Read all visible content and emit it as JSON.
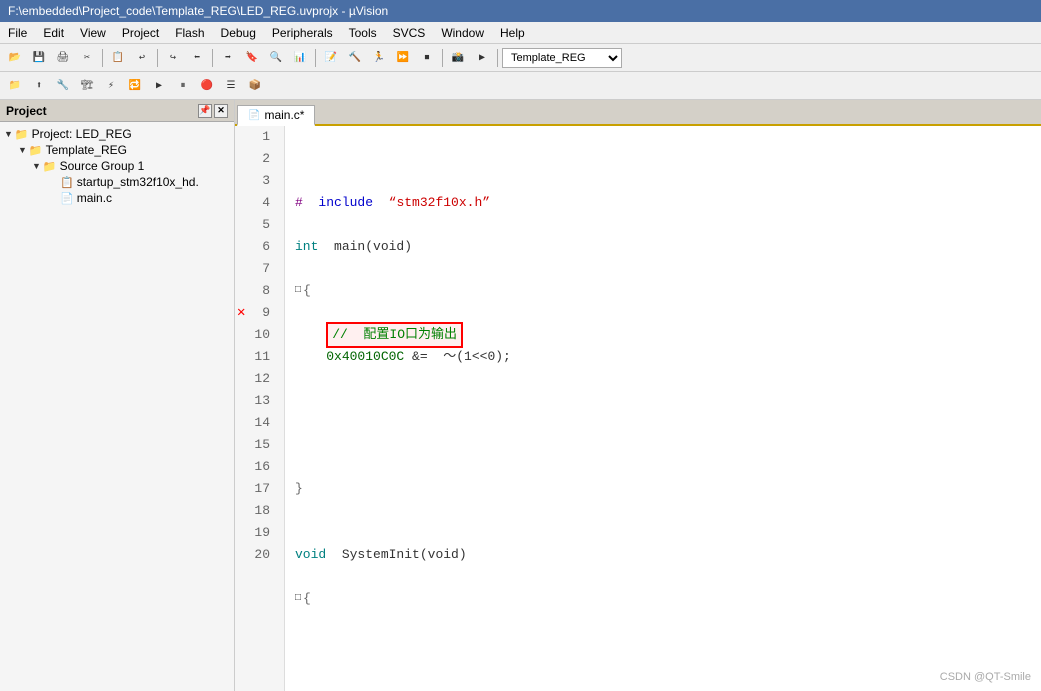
{
  "title": "F:\\embedded\\Project_code\\Template_REG\\LED_REG.uvprojx - µVision",
  "menu": {
    "items": [
      "File",
      "Edit",
      "View",
      "Project",
      "Flash",
      "Debug",
      "Peripherals",
      "Tools",
      "SVCS",
      "Window",
      "Help"
    ]
  },
  "toolbar1": {
    "project_dropdown": "Template_REG"
  },
  "project_panel": {
    "title": "Project",
    "tree": [
      {
        "label": "Project: LED_REG",
        "level": 0,
        "type": "project",
        "expanded": true
      },
      {
        "label": "Template_REG",
        "level": 1,
        "type": "folder",
        "expanded": true
      },
      {
        "label": "Source Group 1",
        "level": 2,
        "type": "folder",
        "expanded": true
      },
      {
        "label": "startup_stm32f10x_hd.",
        "level": 3,
        "type": "asm"
      },
      {
        "label": "main.c",
        "level": 3,
        "type": "c"
      }
    ]
  },
  "editor": {
    "tab_name": "main.c*",
    "lines": [
      {
        "num": 1,
        "content": "",
        "type": "normal"
      },
      {
        "num": 2,
        "content": "#  include  “stm32f10x.h”",
        "type": "include"
      },
      {
        "num": 3,
        "content": "",
        "type": "normal"
      },
      {
        "num": 4,
        "content": "int  main(void)",
        "type": "normal"
      },
      {
        "num": 5,
        "content": "",
        "type": "normal"
      },
      {
        "num": 6,
        "content": "□{",
        "type": "brace"
      },
      {
        "num": 7,
        "content": "",
        "type": "normal"
      },
      {
        "num": 8,
        "content": "    //  配置IO口为输出",
        "type": "comment-highlight"
      },
      {
        "num": 9,
        "content": "    0x40010C0C  &=  ～(1<<0);",
        "type": "code",
        "has_error": true
      },
      {
        "num": 10,
        "content": "",
        "type": "normal"
      },
      {
        "num": 11,
        "content": "",
        "type": "normal"
      },
      {
        "num": 12,
        "content": "",
        "type": "normal"
      },
      {
        "num": 13,
        "content": "",
        "type": "normal"
      },
      {
        "num": 14,
        "content": "",
        "type": "normal"
      },
      {
        "num": 15,
        "content": "}",
        "type": "brace-close"
      },
      {
        "num": 16,
        "content": "",
        "type": "normal"
      },
      {
        "num": 17,
        "content": "",
        "type": "normal"
      },
      {
        "num": 18,
        "content": "void  SystemInit(void)",
        "type": "normal"
      },
      {
        "num": 19,
        "content": "",
        "type": "normal"
      },
      {
        "num": 20,
        "content": "□{",
        "type": "brace"
      }
    ]
  },
  "watermark": "CSDN @QT-Smile"
}
